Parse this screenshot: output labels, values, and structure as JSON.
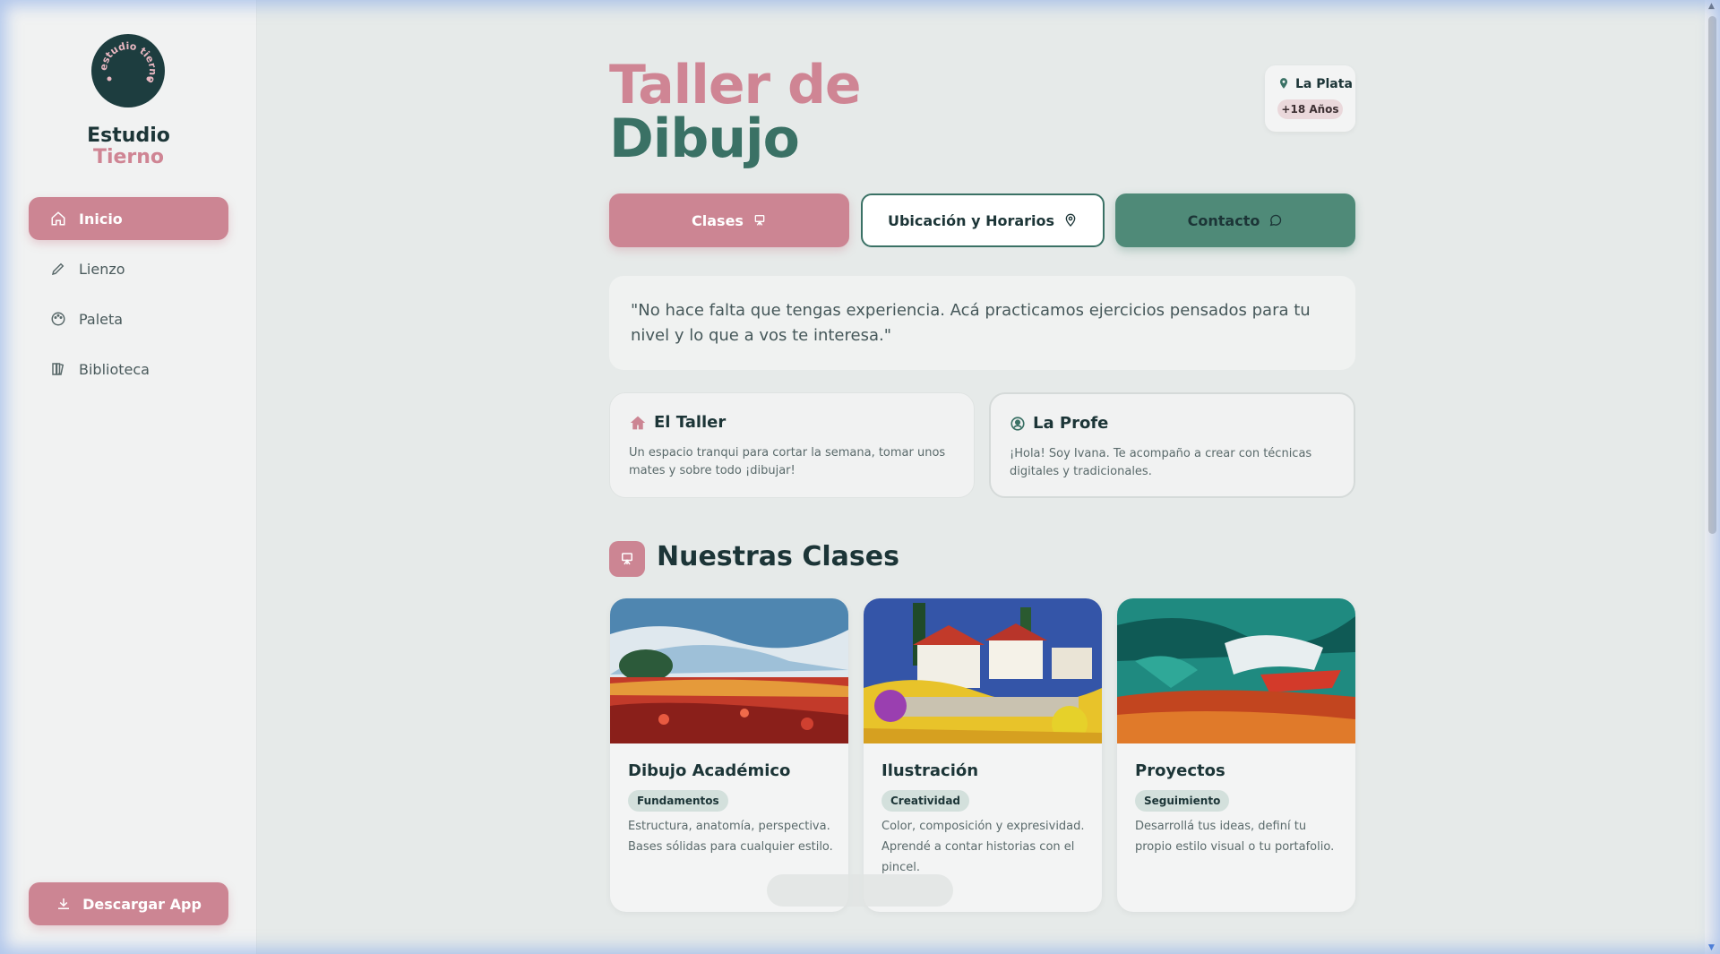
{
  "brand": {
    "logo_text": "estudio tierno",
    "name_line1": "Estudio",
    "name_line2": "Tierno"
  },
  "sidebar": {
    "items": [
      {
        "label": "Inicio",
        "icon": "home-icon",
        "active": true
      },
      {
        "label": "Lienzo",
        "icon": "pencil-icon",
        "active": false
      },
      {
        "label": "Paleta",
        "icon": "palette-icon",
        "active": false
      },
      {
        "label": "Biblioteca",
        "icon": "library-icon",
        "active": false
      }
    ],
    "download_label": "Descargar App"
  },
  "header": {
    "title_line1": "Taller de",
    "title_line2": "Dibujo",
    "location": "La Plata",
    "age_badge": "+18 Años"
  },
  "actions": {
    "clases": "Clases",
    "ubicacion": "Ubicación y Horarios",
    "contacto": "Contacto"
  },
  "quote": "\"No hace falta que tengas experiencia. Acá practicamos ejercicios pensados para tu nivel y lo que a vos te interesa.\"",
  "info_cards": [
    {
      "title": "El Taller",
      "icon": "house-icon",
      "description": "Un espacio tranqui para cortar la semana, tomar unos mates y sobre todo ¡dibujar!"
    },
    {
      "title": "La Profe",
      "icon": "user-circle-icon",
      "description": "¡Hola! Soy Ivana. Te acompaño a crear con técnicas digitales y tradicionales."
    }
  ],
  "section": {
    "title": "Nuestras Clases"
  },
  "classes": [
    {
      "title": "Dibujo Académico",
      "tag": "Fundamentos",
      "description": "Estructura, anatomía, perspectiva. Bases sólidas para cualquier estilo."
    },
    {
      "title": "Ilustración",
      "tag": "Creatividad",
      "description": "Color, composición y expresividad. Aprendé a contar historias con el pincel."
    },
    {
      "title": "Proyectos",
      "tag": "Seguimiento",
      "description": "Desarrollá tus ideas, definí tu propio estilo visual o tu portafolio."
    }
  ],
  "colors": {
    "accent_pink": "#cc8593",
    "accent_green": "#3a7165",
    "button_green": "#4f8a78",
    "dark": "#1c3537"
  }
}
